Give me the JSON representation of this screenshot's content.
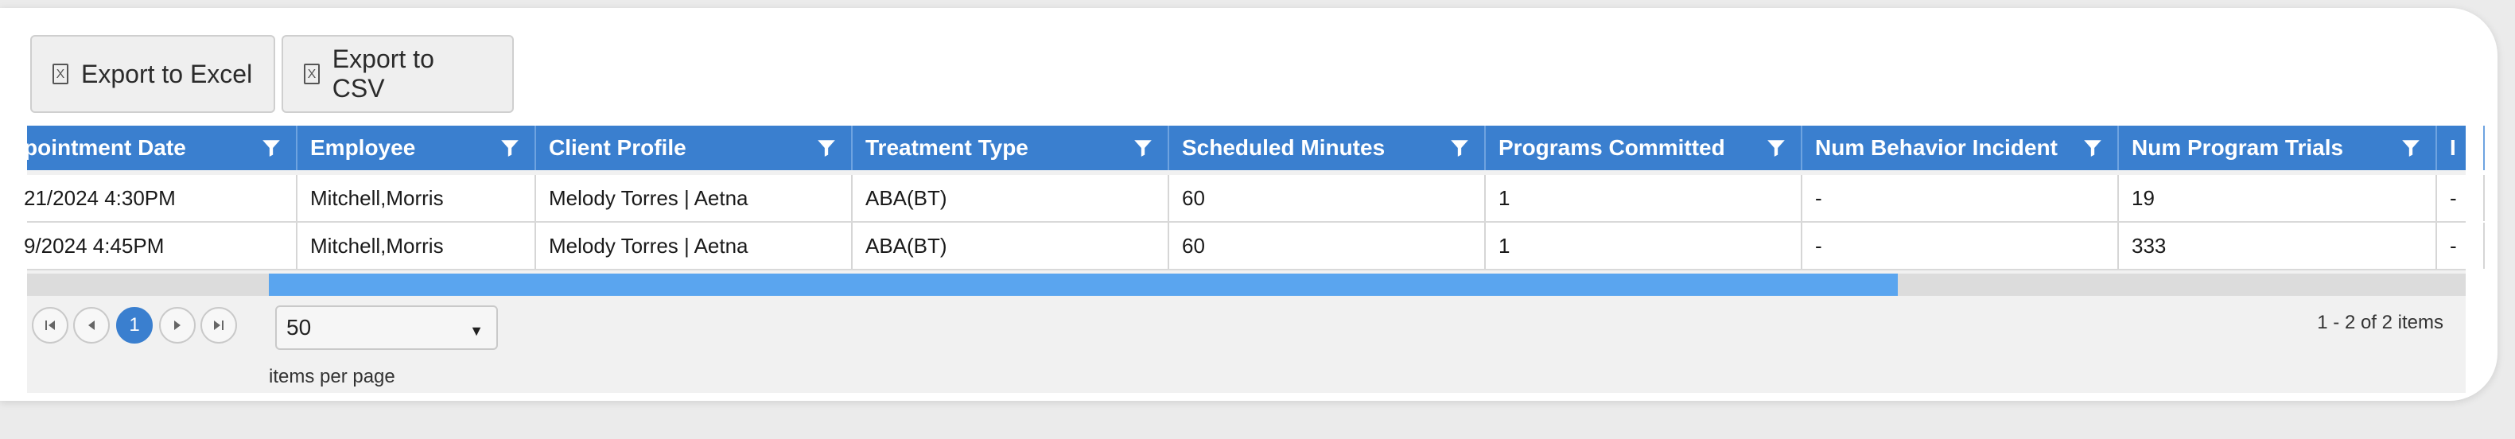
{
  "toolbar": {
    "export_excel": "Export to Excel",
    "export_csv": "Export to CSV"
  },
  "grid": {
    "columns": [
      "pointment Date",
      "Employee",
      "Client Profile",
      "Treatment Type",
      "Scheduled Minutes",
      "Programs Committed",
      "Num Behavior Incident",
      "Num Program Trials",
      "I"
    ],
    "rows": [
      [
        "21/2024 4:30PM",
        "Mitchell,Morris",
        "Melody Torres | Aetna",
        "ABA(BT)",
        "60",
        "1",
        "-",
        "19",
        "-"
      ],
      [
        "9/2024 4:45PM",
        "Mitchell,Morris",
        "Melody Torres | Aetna",
        "ABA(BT)",
        "60",
        "1",
        "-",
        "333",
        "-"
      ]
    ]
  },
  "pager": {
    "current_page": "1",
    "page_size": "50",
    "items_per_page_label": "items per page",
    "summary": "1 - 2 of 2 items"
  },
  "colors": {
    "header_bg": "#3a7fcf",
    "scroll_thumb": "#5aa5ef",
    "active_page": "#3a7fcf"
  }
}
